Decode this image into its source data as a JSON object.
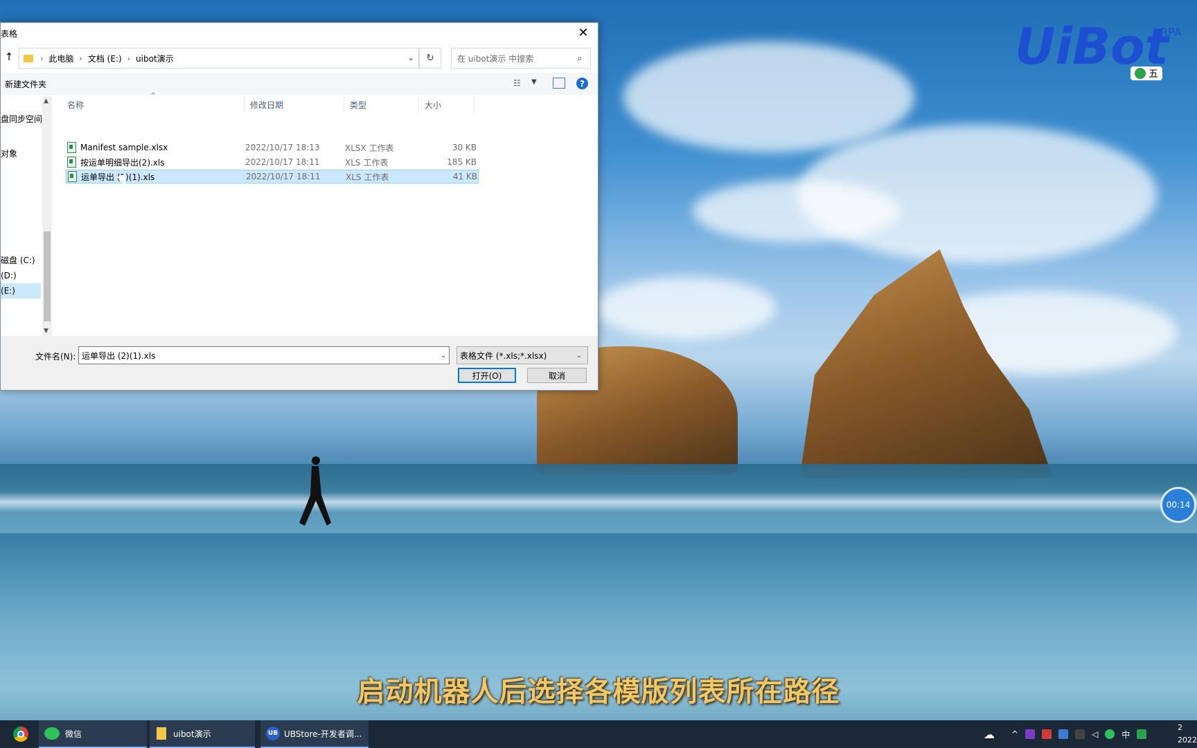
{
  "dialog": {
    "title": "表格",
    "close_glyph": "✕",
    "address": {
      "crumbs": [
        "此电脑",
        "文档 (E:)",
        "uibot演示"
      ]
    },
    "search_placeholder": "在 uibot演示 中搜索",
    "new_folder_label": "新建文件夹",
    "nav_items": [
      "盘同步空间",
      "",
      "对象",
      "磁盘 (C:)",
      "(D:)",
      "(E:)"
    ],
    "columns": [
      "名称",
      "修改日期",
      "类型",
      "大小"
    ],
    "files": [
      {
        "name": "Manifest sample.xlsx",
        "date": "2022/10/17 18:13",
        "type": "XLSX 工作表",
        "size": "30 KB"
      },
      {
        "name": "按运单明细导出(2).xls",
        "date": "2022/10/17 18:11",
        "type": "XLS 工作表",
        "size": "185 KB"
      },
      {
        "name": "运单导出 (2)(1).xls",
        "date": "2022/10/17 18:11",
        "type": "XLS 工作表",
        "size": "41 KB"
      }
    ],
    "filename_label": "文件名(N):",
    "filename_value": "运单导出 (2)(1).xls",
    "filetype_value": "表格文件 (*.xls;*.xlsx)",
    "open_label": "打开(O)",
    "cancel_label": "取消"
  },
  "overlay": {
    "subtitle": "启动机器人后选择各模版列表所在路径",
    "timer": "00:14",
    "logo_text": "UiBot",
    "logo_sup": "RPA",
    "ime_text": "五"
  },
  "taskbar": {
    "items": [
      "微信",
      "uibot演示",
      "UBStore-开发者调..."
    ],
    "ub_icon_text": "UB",
    "tray_ime": "中",
    "clock_line1": "2",
    "clock_line2": "2022"
  }
}
